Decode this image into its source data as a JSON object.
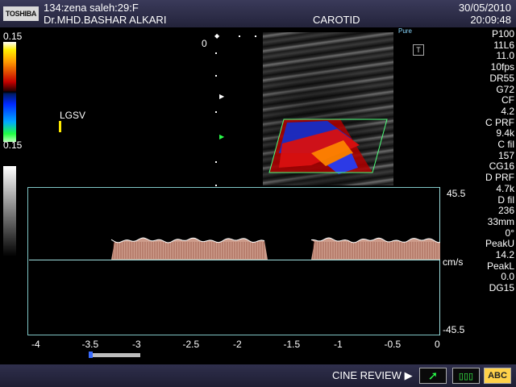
{
  "header": {
    "logo": "TOSHIBA",
    "patient_line": "134:zena  saleh:29:F",
    "doctor": "Dr.MHD.BASHAR ALKARI",
    "exam": "CAROTID",
    "date": "30/05/2010",
    "time": "20:09:48"
  },
  "color_scale": {
    "top": "0.15",
    "bottom": "0.15"
  },
  "vessel_label": "LGSV",
  "depth_zero": "0",
  "image_badges": {
    "pure": "Pure",
    "t": "T"
  },
  "params": [
    "P100",
    "11L6",
    "11.0",
    "10fps",
    "DR55",
    "G72",
    "CF",
    "4.2",
    "C PRF",
    "9.4k",
    "C fil",
    "157",
    "CG16",
    "D PRF",
    "4.7k",
    "D fil",
    "236",
    "33mm",
    "0°",
    "PeakU",
    "14.2",
    "PeakL",
    "0.0",
    "DG15"
  ],
  "doppler": {
    "scale_top": "45.5",
    "unit": "cm/s",
    "scale_bottom": "-45.5",
    "time_ticks": [
      "-4",
      "-3.5",
      "-3",
      "-2.5",
      "-2",
      "-1.5",
      "-1",
      "-0.5",
      "0"
    ]
  },
  "footer": {
    "mode": "CINE REVIEW ▶",
    "abc": "ABC"
  },
  "colors": {
    "flow": "#f1b7a3",
    "baseline": "#9fe0e0"
  }
}
